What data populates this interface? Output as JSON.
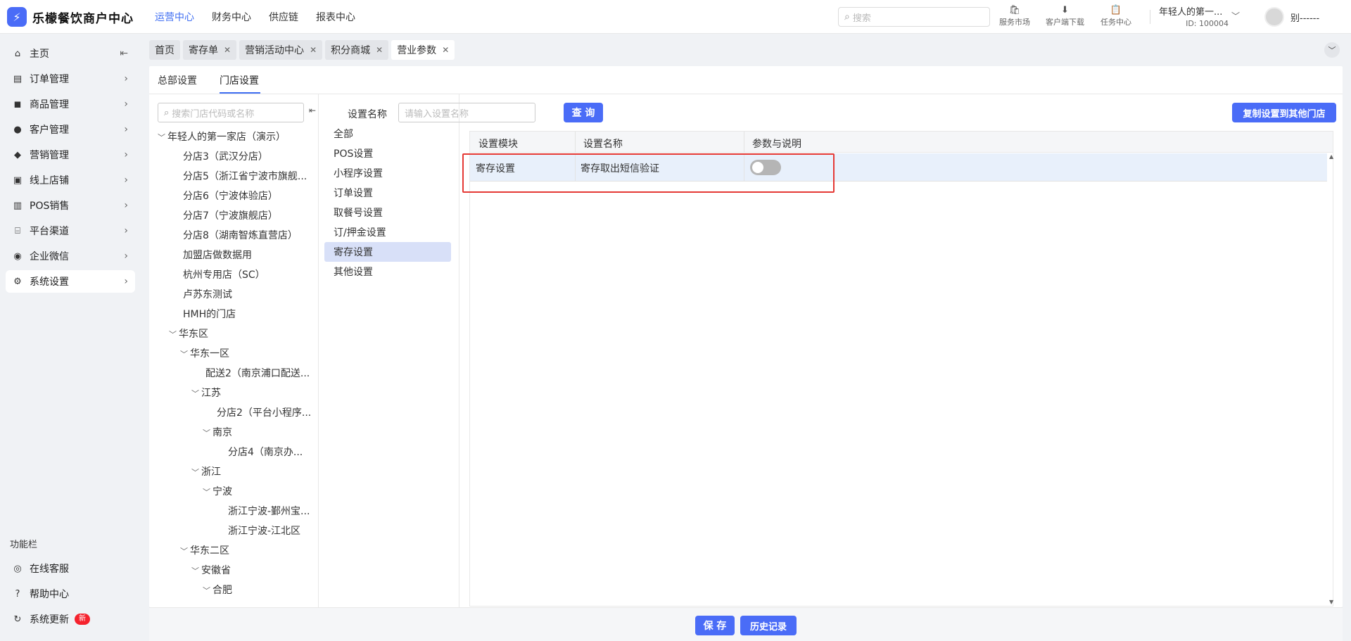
{
  "app": {
    "logo_char": "⚡",
    "name": "乐檬餐饮商户中心"
  },
  "topnav": [
    "运营中心",
    "财务中心",
    "供应链",
    "报表中心"
  ],
  "search": {
    "placeholder": "搜索"
  },
  "tools": [
    {
      "label": "服务市场",
      "icon": "shop-icon"
    },
    {
      "label": "客户端下载",
      "icon": "download-icon"
    },
    {
      "label": "任务中心",
      "icon": "task-icon"
    }
  ],
  "store": {
    "name": "年轻人的第一...",
    "id": "ID: 100004"
  },
  "user": {
    "name": "别------"
  },
  "sidebar": {
    "items": [
      {
        "label": "主页",
        "icon": "home-icon"
      },
      {
        "label": "订单管理",
        "icon": "order-icon"
      },
      {
        "label": "商品管理",
        "icon": "goods-icon"
      },
      {
        "label": "客户管理",
        "icon": "customer-icon"
      },
      {
        "label": "营销管理",
        "icon": "tag-icon"
      },
      {
        "label": "线上店铺",
        "icon": "store-icon"
      },
      {
        "label": "POS销售",
        "icon": "pos-icon"
      },
      {
        "label": "平台渠道",
        "icon": "bank-icon"
      },
      {
        "label": "企业微信",
        "icon": "wechat-icon"
      },
      {
        "label": "系统设置",
        "icon": "gear-icon"
      }
    ],
    "func_title": "功能栏",
    "func_items": [
      {
        "label": "在线客服",
        "icon": "support-icon"
      },
      {
        "label": "帮助中心",
        "icon": "help-icon"
      },
      {
        "label": "系统更新",
        "icon": "refresh-icon",
        "badge": "新"
      }
    ]
  },
  "tabs": [
    {
      "label": "首页",
      "closable": false
    },
    {
      "label": "寄存单",
      "closable": true
    },
    {
      "label": "营销活动中心",
      "closable": true
    },
    {
      "label": "积分商城",
      "closable": true
    },
    {
      "label": "营业参数",
      "closable": true,
      "active": true
    }
  ],
  "subtabs": [
    "总部设置",
    "门店设置"
  ],
  "tree": {
    "search_placeholder": "搜索门店代码或名称",
    "nodes": [
      "年轻人的第一家店（演示）",
      "分店3（武汉分店）",
      "分店5（浙江省宁波市旗舰...",
      "分店6（宁波体验店）",
      "分店7（宁波旗舰店）",
      "分店8（湖南智炼直营店）",
      "加盟店做数据用",
      "杭州专用店（SC）",
      "卢苏东测试",
      "HMH的门店",
      "华东区",
      "华东一区",
      "配送2（南京浦口配送...",
      "江苏",
      "分店2（平台小程序...",
      "南京",
      "分店4（南京办...",
      "浙江",
      "宁波",
      "浙江宁波-鄞州宝...",
      "浙江宁波-江北区",
      "华东二区",
      "安徽省",
      "合肥"
    ]
  },
  "filter": {
    "label": "设置名称",
    "placeholder": "请输入设置名称",
    "query_button": "查 询",
    "copy_button": "复制设置到其他门店"
  },
  "categories": [
    "全部",
    "POS设置",
    "小程序设置",
    "订单设置",
    "取餐号设置",
    "订/押金设置",
    "寄存设置",
    "其他设置"
  ],
  "table": {
    "headers": [
      "设置模块",
      "设置名称",
      "参数与说明"
    ],
    "rows": [
      {
        "module": "寄存设置",
        "name": "寄存取出短信验证",
        "enabled": false
      }
    ]
  },
  "footer": {
    "save": "保 存",
    "history": "历史记录"
  }
}
